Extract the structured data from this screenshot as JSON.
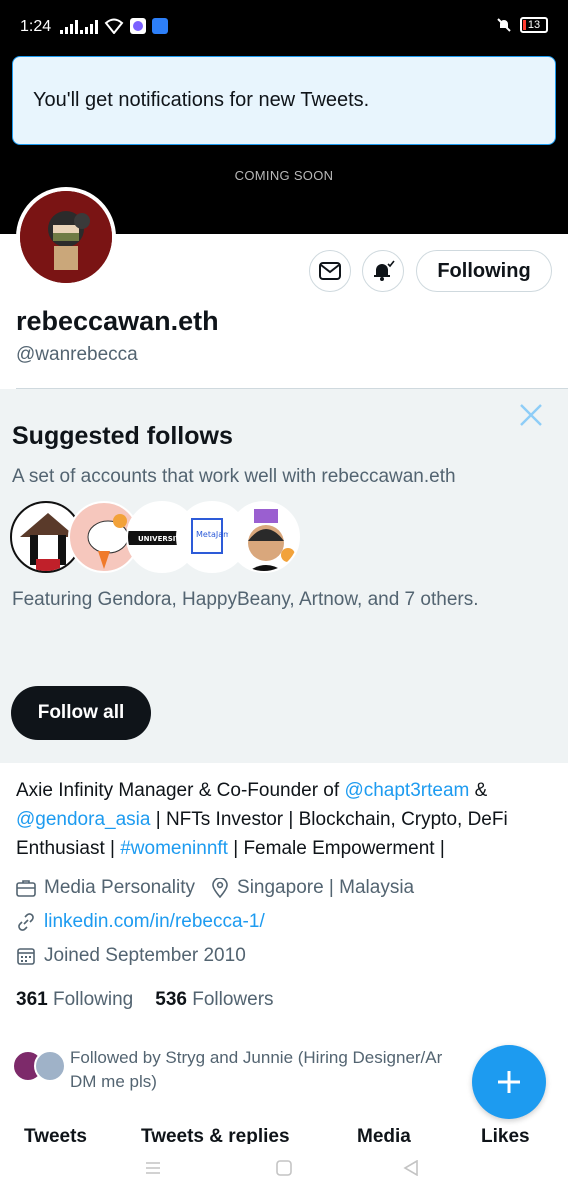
{
  "status_bar": {
    "time": "1:24",
    "battery": "13"
  },
  "toast": {
    "message": "You'll get notifications for new Tweets."
  },
  "banner": {
    "text": "COMING SOON"
  },
  "profile": {
    "display_name": "rebeccawan.eth",
    "handle": "@wanrebecca",
    "following_button": "Following"
  },
  "suggested": {
    "title": "Suggested follows",
    "subtitle": "A set of accounts that work well with rebeccawan.eth",
    "featuring": "Featuring Gendora, HappyBeany, Artnow, and 7 others.",
    "follow_all": "Follow all",
    "avatar_labels": [
      "UNIVERSITY.ETH",
      "MetaJam Asia"
    ]
  },
  "bio": {
    "part1": "Axie Infinity Manager & Co-Founder of ",
    "mention1": "@chapt3rteam",
    "part2": " & ",
    "mention2": "@gendora_asia",
    "part3": " | NFTs Investor | Blockchain, Crypto, DeFi Enthusiast | ",
    "hashtag": "#womeninnft",
    "part4": " | Female Empowerment |"
  },
  "meta": {
    "category": "Media Personality",
    "location": "Singapore | Malaysia",
    "website": "linkedin.com/in/rebecca-1/",
    "joined": "Joined September 2010"
  },
  "counts": {
    "following_count": "361",
    "following_label": "Following",
    "followers_count": "536",
    "followers_label": "Followers"
  },
  "followed_by": {
    "line1": "Followed by Stryg and Junnie (Hiring Designer/Ar",
    "line2": "DM me pls)"
  },
  "tabs": [
    "Tweets",
    "Tweets & replies",
    "Media",
    "Likes"
  ],
  "colors": {
    "accent": "#1d9bf0",
    "text": "#0f1419",
    "muted": "#536471",
    "panel": "#eff3f4"
  }
}
